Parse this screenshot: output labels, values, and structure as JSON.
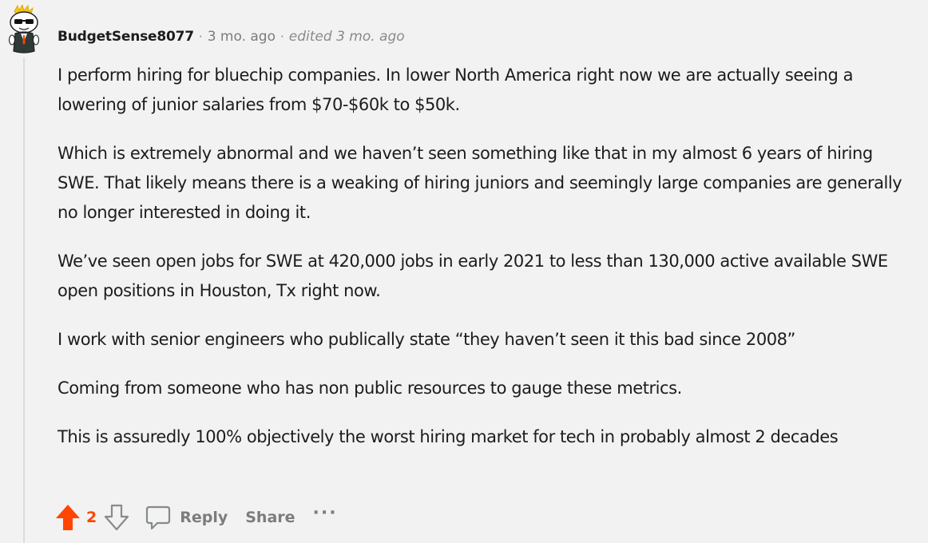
{
  "comment": {
    "author": "BudgetSense8077",
    "separator": "·",
    "time_ago": "3 mo. ago",
    "edited": "edited 3 mo. ago",
    "paragraphs": [
      "I perform hiring for bluechip companies. In lower North America right now we are actually seeing a lowering of junior salaries from $70-$60k to $50k.",
      "Which is extremely abnormal and we haven’t seen something like that in my almost 6 years of hiring SWE. That likely means there is a weaking of hiring juniors and seemingly large companies are generally no longer interested in doing it.",
      "We’ve seen open jobs for SWE at 420,000 jobs in early 2021 to less than 130,000 active available SWE open positions in Houston, Tx right now.",
      "I work with senior engineers who publically state “they haven’t seen it this bad since 2008”",
      "Coming from someone who has non public resources to gauge these metrics.",
      "This is assuredly 100% objectively the worst hiring market for tech in probably almost 2 decades"
    ],
    "actions": {
      "score": "2",
      "reply_label": "Reply",
      "share_label": "Share",
      "more_label": "···"
    }
  },
  "colors": {
    "background": "#f2f2f2",
    "upvote_active": "#ff4500",
    "muted": "#7c7c7c",
    "text": "#1c1c1c"
  },
  "icons": {
    "upvote": "upvote-arrow-icon",
    "downvote": "downvote-arrow-icon",
    "reply": "comment-bubble-icon",
    "avatar": "snoo-avatar"
  }
}
